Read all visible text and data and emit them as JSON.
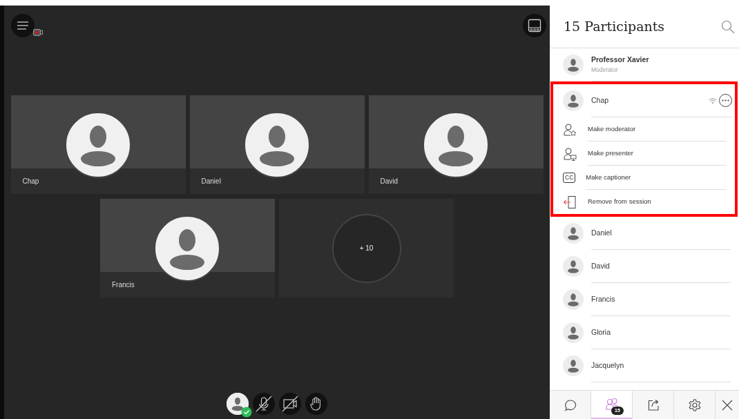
{
  "stage": {
    "recording": true,
    "tiles": [
      {
        "kind": "person",
        "name": "Chap"
      },
      {
        "kind": "person",
        "name": "Daniel"
      },
      {
        "kind": "person",
        "name": "David"
      },
      {
        "kind": "person",
        "name": "Francis"
      },
      {
        "kind": "more",
        "label": "+ 10"
      }
    ],
    "controls": [
      {
        "kind": "avatar",
        "on": true
      },
      {
        "kind": "mic",
        "on": false
      },
      {
        "kind": "camera",
        "on": false
      },
      {
        "kind": "hand",
        "on": false
      }
    ]
  },
  "panel": {
    "title": "15 Participants",
    "participants": [
      {
        "name": "Professor Xavier",
        "role": "Moderator",
        "highlighted": false
      },
      {
        "name": "Chap",
        "highlighted": true,
        "menu": [
          {
            "kind": "moderator",
            "label": "Make moderator"
          },
          {
            "kind": "presenter",
            "label": "Make presenter"
          },
          {
            "kind": "captioner",
            "icon_text": "CC",
            "label": "Make captioner"
          },
          {
            "kind": "remove",
            "label": "Remove from session"
          }
        ]
      },
      {
        "name": "Daniel",
        "highlighted": false
      },
      {
        "name": "David",
        "highlighted": false
      },
      {
        "name": "Francis",
        "highlighted": false
      },
      {
        "name": "Gloria",
        "highlighted": false
      },
      {
        "name": "Jacquelyn",
        "highlighted": false
      }
    ]
  },
  "tabs": [
    {
      "kind": "chat",
      "selected": false
    },
    {
      "kind": "participants",
      "selected": true,
      "badge": "15"
    },
    {
      "kind": "share",
      "selected": false
    },
    {
      "kind": "settings",
      "selected": false
    },
    {
      "kind": "close",
      "selected": false
    }
  ]
}
